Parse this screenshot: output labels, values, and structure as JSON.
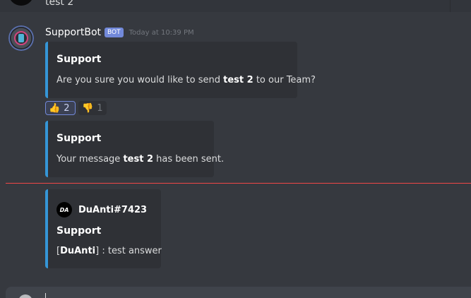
{
  "previous_message": {
    "text": "test 2"
  },
  "bot_message": {
    "username": "SupportBot",
    "bot_tag": "BOT",
    "timestamp": "Today at 10:39 PM"
  },
  "embeds": [
    {
      "title": "Support",
      "desc_prefix": "Are you sure you would like to send ",
      "desc_bold": "test 2",
      "desc_suffix": " to our Team?"
    },
    {
      "title": "Support",
      "desc_prefix": "Your message ",
      "desc_bold": "test 2",
      "desc_suffix": " has been sent."
    },
    {
      "author_icon": "DA",
      "author_name": "DuAnti#7423",
      "title": "Support",
      "desc_prefix": "[",
      "desc_bold": "DuAnti",
      "desc_suffix": "] : test answer"
    }
  ],
  "reactions": [
    {
      "emoji": "👍",
      "count": "2",
      "icon": "thumbs-up-icon",
      "reacted": true
    },
    {
      "emoji": "👎",
      "count": "1",
      "icon": "thumbs-down-icon",
      "reacted": false
    }
  ],
  "colors": {
    "background": "#36393f",
    "embed_bg": "#2f3136",
    "embed_accent": "#3596d7",
    "bot_tag": "#7289da",
    "new_message_divider": "#f04747"
  }
}
